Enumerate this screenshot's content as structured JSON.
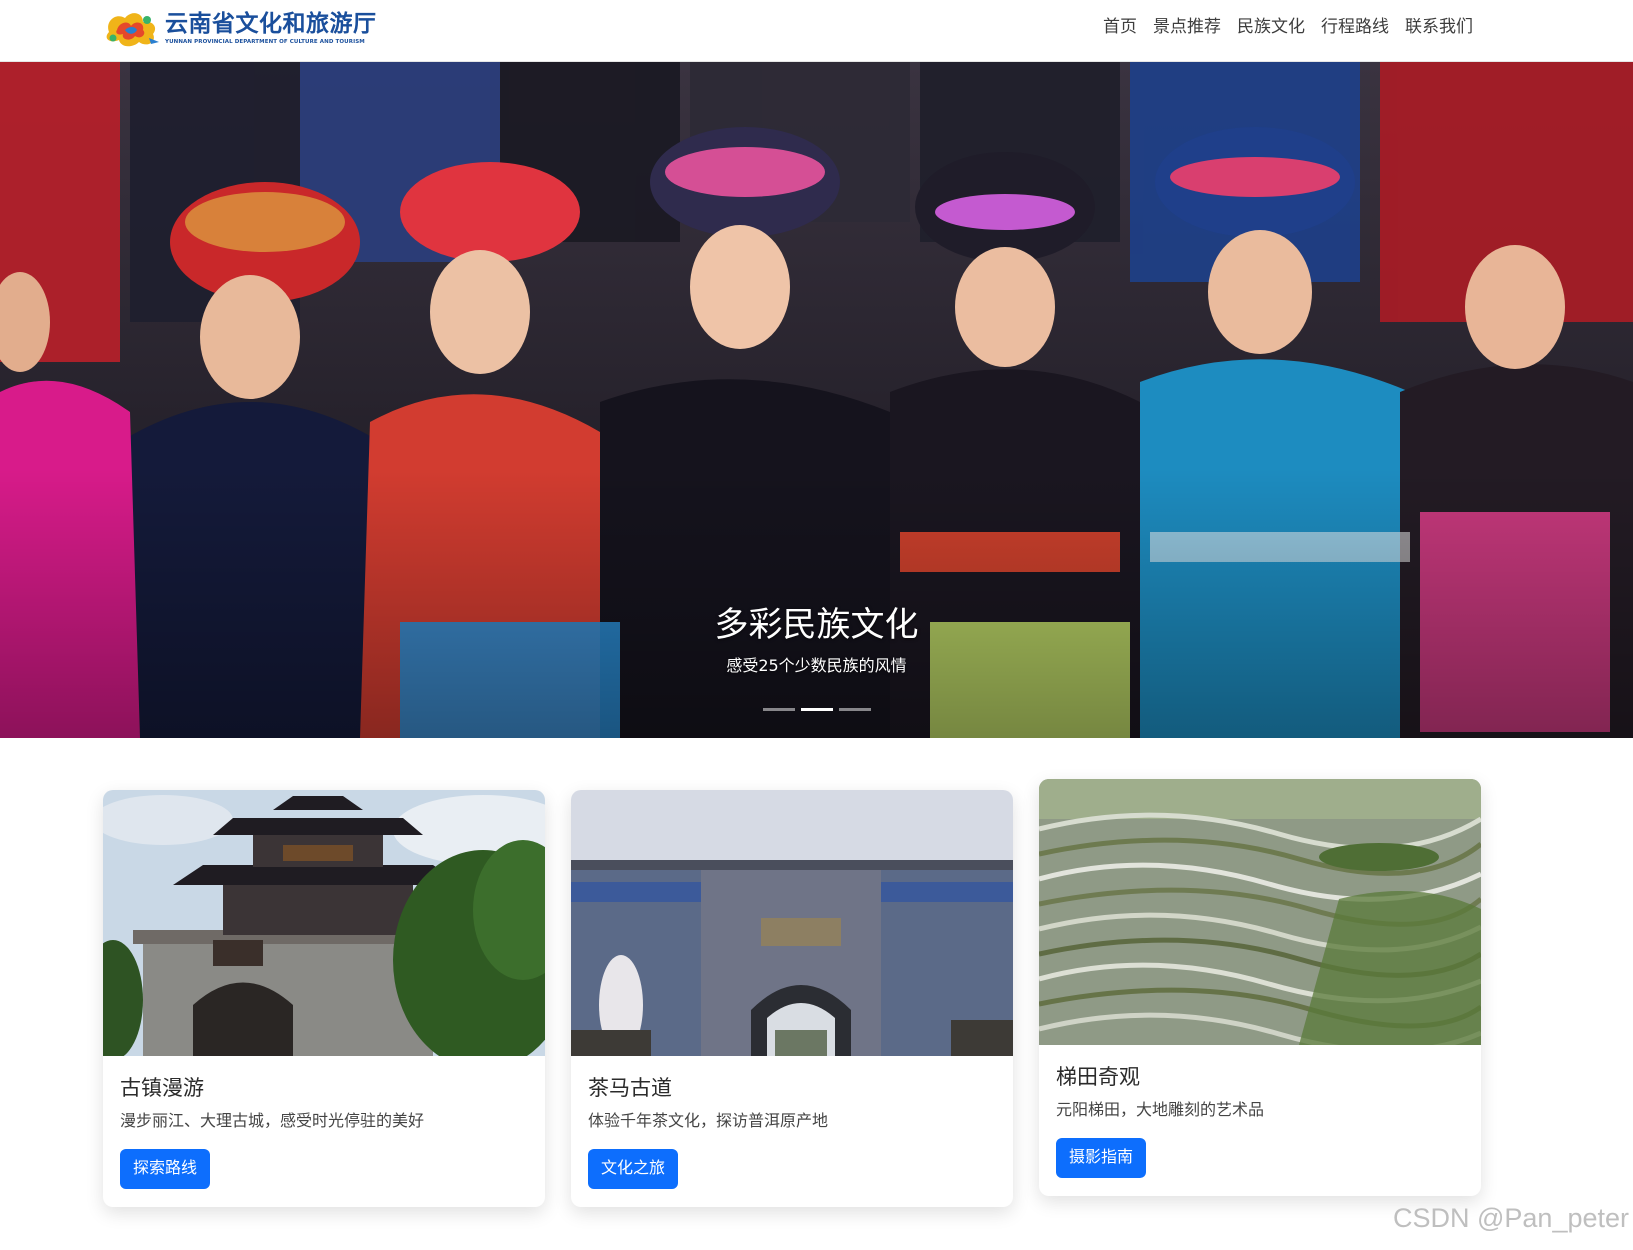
{
  "navbar": {
    "brand_cn": "云南省文化和旅游厅",
    "brand_en": "YUNNAN PROVINCIAL DEPARTMENT OF CULTURE AND TOURISM",
    "links": [
      "首页",
      "景点推荐",
      "民族文化",
      "行程路线",
      "联系我们"
    ]
  },
  "hero": {
    "title": "多彩民族文化",
    "subtitle": "感受25个少数民族的风情",
    "slide_count": 3,
    "active_slide": 2
  },
  "cards": [
    {
      "title": "古镇漫游",
      "text": "漫步丽江、大理古城，感受时光停驻的美好",
      "button": "探索路线"
    },
    {
      "title": "茶马古道",
      "text": "体验千年茶文化，探访普洱原产地",
      "button": "文化之旅"
    },
    {
      "title": "梯田奇观",
      "text": "元阳梯田，大地雕刻的艺术品",
      "button": "摄影指南"
    }
  ],
  "watermark": "CSDN @Pan_peter",
  "colors": {
    "brand": "#1a4f9c",
    "primary_button": "#0d6efd"
  },
  "icons": {
    "logo": "yunnan-culture-tourism-logo"
  }
}
